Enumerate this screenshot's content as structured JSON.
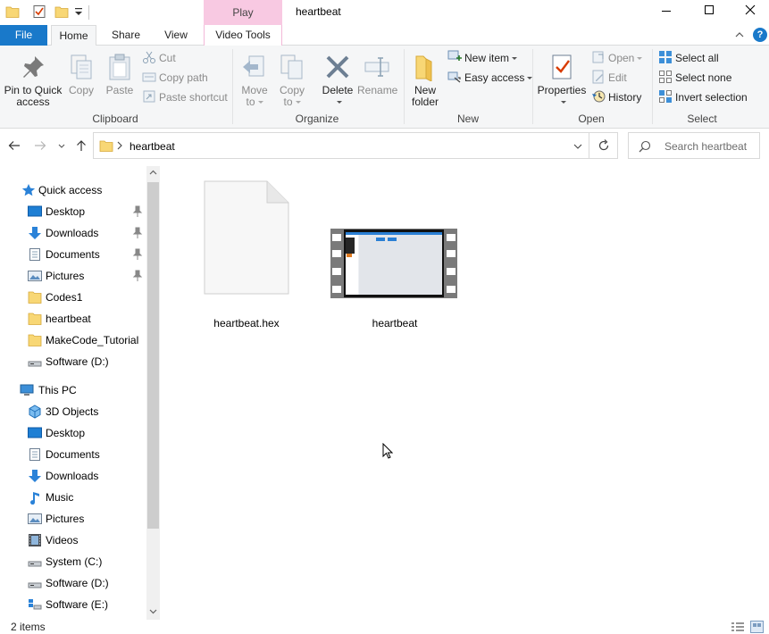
{
  "window": {
    "title": "heartbeat",
    "context_tab_group": "Play"
  },
  "tabs": [
    {
      "label": "File"
    },
    {
      "label": "Home"
    },
    {
      "label": "Share"
    },
    {
      "label": "View"
    },
    {
      "label": "Video Tools"
    }
  ],
  "ribbon": {
    "clipboard": {
      "group_label": "Clipboard",
      "pin_line1": "Pin to Quick",
      "pin_line2": "access",
      "copy": "Copy",
      "paste": "Paste",
      "cut": "Cut",
      "copy_path": "Copy path",
      "paste_shortcut": "Paste shortcut"
    },
    "organize": {
      "group_label": "Organize",
      "move_line1": "Move",
      "move_line2": "to",
      "copy_line1": "Copy",
      "copy_line2": "to",
      "delete": "Delete",
      "rename": "Rename"
    },
    "new": {
      "group_label": "New",
      "new_folder_line1": "New",
      "new_folder_line2": "folder",
      "new_item": "New item",
      "easy_access": "Easy access"
    },
    "open": {
      "group_label": "Open",
      "properties": "Properties",
      "open": "Open",
      "edit": "Edit",
      "history": "History"
    },
    "select": {
      "group_label": "Select",
      "select_all": "Select all",
      "select_none": "Select none",
      "invert_selection": "Invert selection"
    },
    "help": "?"
  },
  "address": {
    "path": "heartbeat",
    "search_placeholder": "Search heartbeat"
  },
  "nav_pane": {
    "quick_access": "Quick access",
    "quick_items": [
      {
        "label": "Desktop",
        "pinned": true
      },
      {
        "label": "Downloads",
        "pinned": true
      },
      {
        "label": "Documents",
        "pinned": true
      },
      {
        "label": "Pictures",
        "pinned": true
      },
      {
        "label": "Codes1",
        "pinned": false
      },
      {
        "label": "heartbeat",
        "pinned": false
      },
      {
        "label": "MakeCode_Tutorial",
        "pinned": false
      },
      {
        "label": "Software (D:)",
        "pinned": false
      }
    ],
    "this_pc": "This PC",
    "pc_items": [
      {
        "label": "3D Objects"
      },
      {
        "label": "Desktop"
      },
      {
        "label": "Documents"
      },
      {
        "label": "Downloads"
      },
      {
        "label": "Music"
      },
      {
        "label": "Pictures"
      },
      {
        "label": "Videos"
      },
      {
        "label": "System (C:)"
      },
      {
        "label": "Software (D:)"
      },
      {
        "label": "Software (E:)"
      }
    ]
  },
  "files": [
    {
      "name": "heartbeat.hex",
      "type": "document-file"
    },
    {
      "name": "heartbeat",
      "type": "video-file"
    }
  ],
  "status": {
    "item_count": "2 items"
  },
  "colors": {
    "file_tab": "#1979ca",
    "play_tab": "#f8c9e2",
    "folder": "#f8d775",
    "ribbon_bg": "#f5f6f7"
  }
}
